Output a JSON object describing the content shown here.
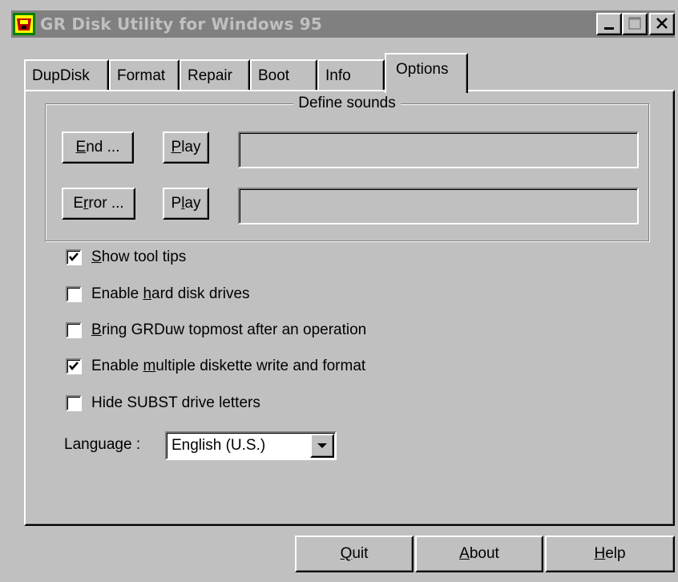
{
  "window": {
    "title": "GR Disk Utility for Windows 95"
  },
  "tabs": [
    {
      "label": "DupDisk"
    },
    {
      "label": "Format"
    },
    {
      "label": "Repair"
    },
    {
      "label": "Boot"
    },
    {
      "label": "Info"
    },
    {
      "label": "Options"
    }
  ],
  "active_tab": "Options",
  "sounds": {
    "group_title": "Define sounds",
    "end_button": {
      "pre": "",
      "mnemonic": "E",
      "post": "nd ..."
    },
    "end_play": {
      "pre": "",
      "mnemonic": "P",
      "post": "lay"
    },
    "end_path": "",
    "error_button": {
      "pre": "E",
      "mnemonic": "r",
      "post": "ror ..."
    },
    "error_play": {
      "pre": "P",
      "mnemonic": "l",
      "post": "ay"
    },
    "error_path": ""
  },
  "options": [
    {
      "pre": "",
      "mnemonic": "S",
      "post": "how tool tips",
      "checked": true
    },
    {
      "pre": "Enable ",
      "mnemonic": "h",
      "post": "ard disk drives",
      "checked": false
    },
    {
      "pre": "",
      "mnemonic": "B",
      "post": "ring GRDuw topmost after an operation",
      "checked": false
    },
    {
      "pre": "Enable ",
      "mnemonic": "m",
      "post": "ultiple diskette write and format",
      "checked": true
    },
    {
      "pre": "Hide SUBST drive letters",
      "mnemonic": "",
      "post": "",
      "checked": false
    }
  ],
  "language": {
    "label": "Language :",
    "value": "English (U.S.)"
  },
  "buttons": {
    "quit": {
      "pre": "",
      "mnemonic": "Q",
      "post": "uit"
    },
    "about": {
      "pre": "",
      "mnemonic": "A",
      "post": "bout"
    },
    "help": {
      "pre": "",
      "mnemonic": "H",
      "post": "elp"
    }
  },
  "colors": {
    "face": "#c0c0c0",
    "title_inactive": "#808080",
    "title_text": "#c0c0c0",
    "icon_red": "#c00000",
    "icon_yellow": "#ffff00",
    "icon_green": "#008000"
  },
  "icons": {
    "app": "gr-disk-utility-icon",
    "minimize": "minimize-icon",
    "maximize": "maximize-icon",
    "close": "close-icon",
    "dropdown": "chevron-down-icon",
    "check": "checkmark-icon"
  }
}
